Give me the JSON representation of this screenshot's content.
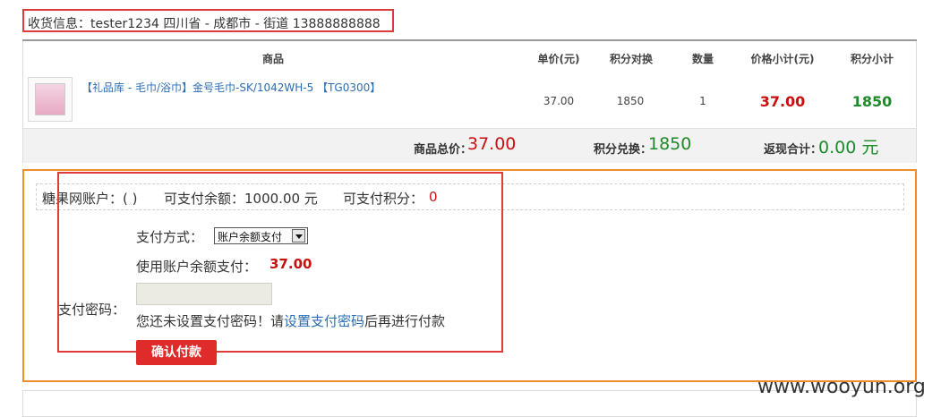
{
  "shipping": {
    "text": "收货信息：tester1234 四川省 - 成都市 - 街道 13888888888"
  },
  "table": {
    "headers": {
      "product": "商品",
      "unit_price": "单价(元)",
      "points_exchange": "积分对换",
      "quantity": "数量",
      "subtotal": "价格小计(元)",
      "points_subtotal": "积分小计"
    },
    "row": {
      "name": "【礼品库 - 毛巾/浴巾】金号毛巾-SK/1042WH-5 【TG0300】",
      "unit_price": "37.00",
      "points_exchange": "1850",
      "quantity": "1",
      "subtotal": "37.00",
      "points_subtotal": "1850"
    }
  },
  "summary": {
    "total_label": "商品总价：",
    "total_value": "37.00",
    "points_label": "积分兑换：",
    "points_value": "1850",
    "cashback_label": "返现合计：",
    "cashback_value": "0.00 元"
  },
  "payment": {
    "account_label": "糖果网账户：( )",
    "balance_label": "可支付余额：1000.00 元",
    "points_label": "可支付积分：",
    "points_value": "0",
    "method_label": "支付方式：",
    "method_selected": "账户余额支付",
    "balance_pay_label": "使用账户余额支付：",
    "balance_pay_value": "37.00",
    "password_label": "支付密码：",
    "notice_prefix": "您还未设置支付密码！请",
    "notice_link": "设置支付密码",
    "notice_suffix": "后再进行付款",
    "confirm_button": "确认付款"
  },
  "watermark": "www.wooyun.org",
  "colors": {
    "price_red": "#c81010",
    "points_green": "#1f8a2a",
    "link_blue": "#2b6cb3",
    "button_red": "#e02b2b",
    "highlight_orange": "#f08c2a",
    "highlight_red": "#e03b3b"
  }
}
